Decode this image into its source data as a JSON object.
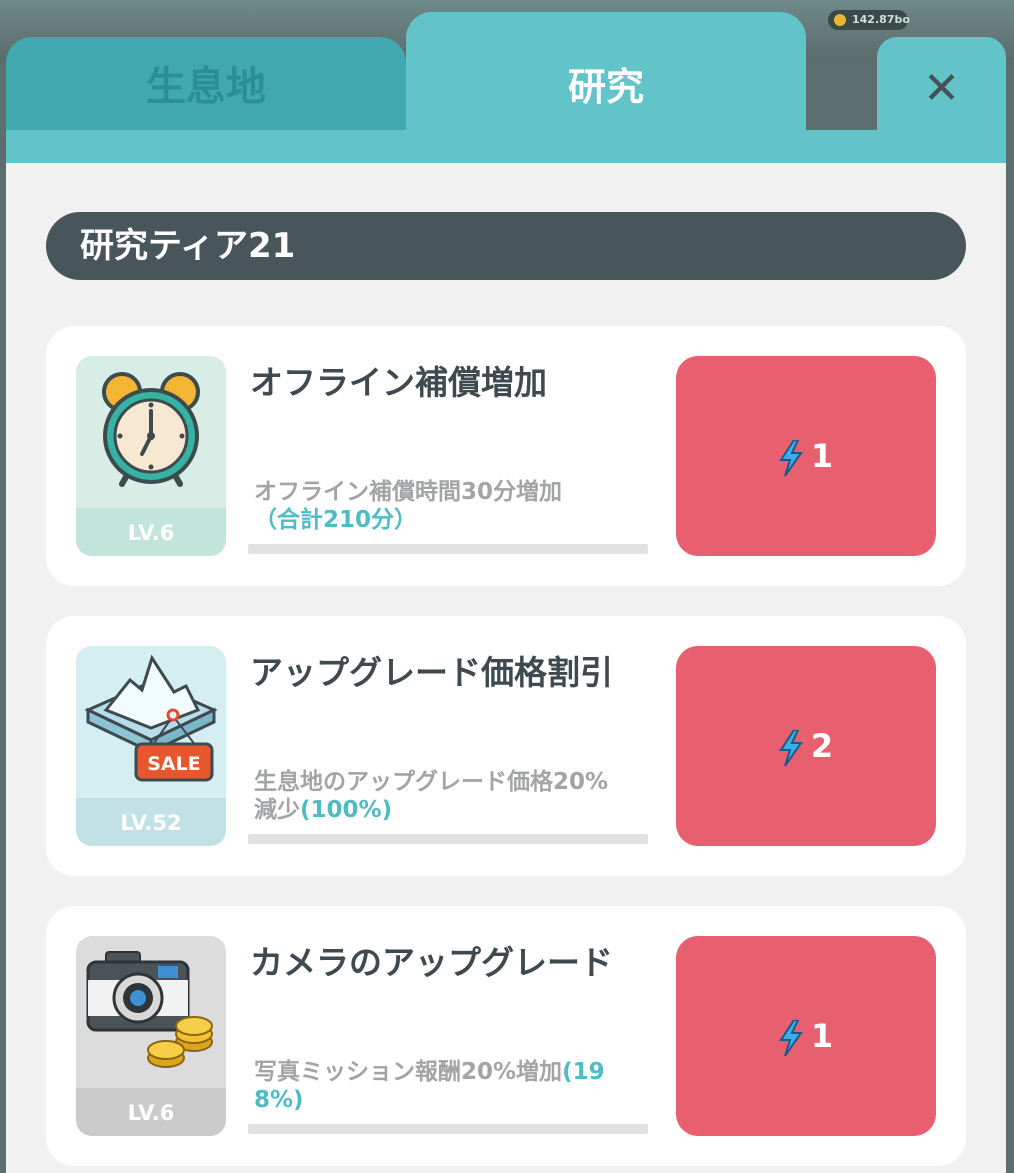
{
  "currency": {
    "amount": "142.87bo",
    "icon": "gold-coin-icon"
  },
  "tabs": {
    "habitat": "生息地",
    "research": "研究",
    "close": "✕"
  },
  "tier": {
    "label": "研究ティア21"
  },
  "research_items": [
    {
      "icon": "alarm-clock-icon",
      "title": "オフライン補償増加",
      "level": "LV.6",
      "description": "オフライン補償時間30分増加",
      "highlight": "（合計210分）",
      "cost": "1",
      "progress": 0
    },
    {
      "icon": "sale-iceberg-icon",
      "title": "アップグレード価格割引",
      "level": "LV.52",
      "description": "生息地のアップグレード価格20%減少",
      "highlight": "(100%)",
      "cost": "2",
      "progress": 0,
      "sale_label": "SALE"
    },
    {
      "icon": "camera-coins-icon",
      "title": "カメラのアップグレード",
      "level": "LV.6",
      "description": "写真ミッション報酬20%増加",
      "highlight": "(198%)",
      "cost": "1",
      "progress": 0
    }
  ],
  "colors": {
    "teal": "#62c3c9",
    "teal_dark": "#41a8b0",
    "button_red": "#e86070",
    "tier_bar": "#48555b",
    "bolt_blue": "#3aaee8"
  }
}
